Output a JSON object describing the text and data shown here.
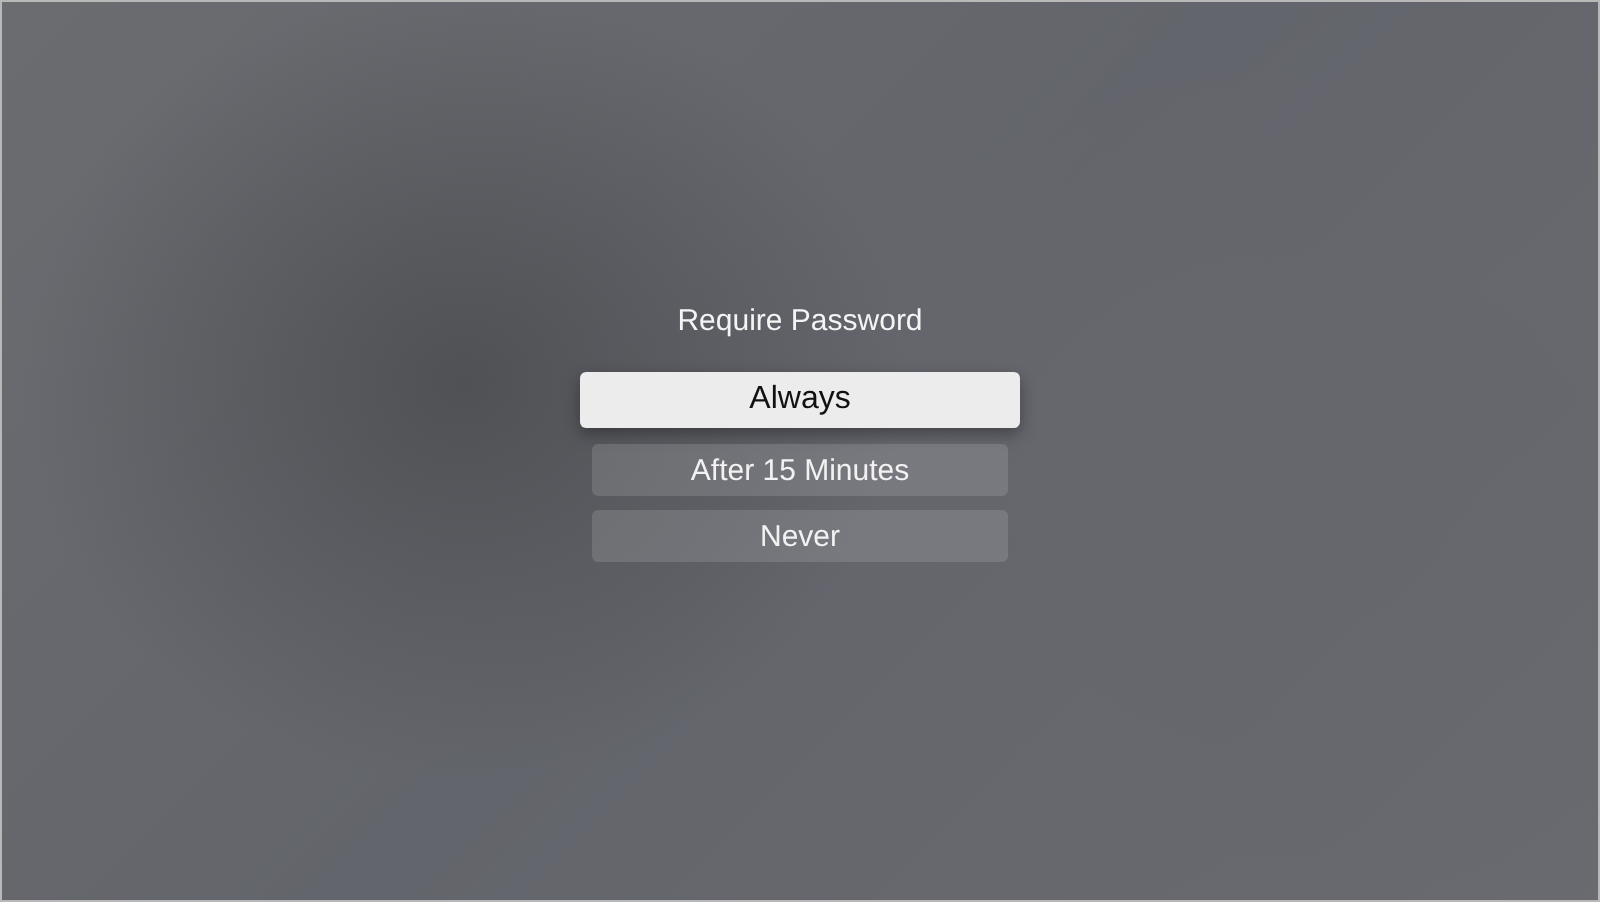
{
  "title": "Require Password",
  "options": [
    {
      "label": "Always",
      "selected": true
    },
    {
      "label": "After 15 Minutes",
      "selected": false
    },
    {
      "label": "Never",
      "selected": false
    }
  ]
}
